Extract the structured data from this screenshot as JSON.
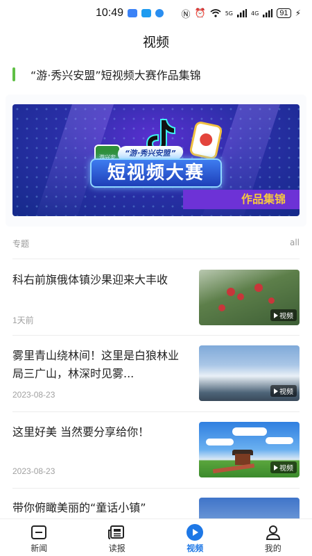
{
  "status_bar": {
    "time": "10:49",
    "battery": "91",
    "network_labels": [
      "5G",
      "4G"
    ]
  },
  "header": {
    "title": "视频"
  },
  "collection": {
    "title": "“游·秀兴安盟”短视频大赛作品集锦"
  },
  "banner": {
    "logo_text": "游兴安",
    "subtitle": "“游·秀兴安盟”",
    "main_text": "短视频大赛",
    "tag_text": "作品集锦"
  },
  "section": {
    "label": "专题",
    "more": "all"
  },
  "video_badge_label": "视频",
  "news_items": [
    {
      "title": "科右前旗俄体镇沙果迎来大丰收",
      "date": "1天前"
    },
    {
      "title": "雾里青山绕林间！这里是白狼林业局三广山，林深时见雾...",
      "date": "2023-08-23"
    },
    {
      "title": "这里好美 当然要分享给你！",
      "date": "2023-08-23"
    },
    {
      "title": "带你俯瞰美丽的“童话小镇”",
      "date": ""
    }
  ],
  "tabbar": {
    "items": [
      {
        "label": "新闻",
        "icon": "news-icon"
      },
      {
        "label": "读报",
        "icon": "newspaper-icon"
      },
      {
        "label": "视频",
        "icon": "play-icon"
      },
      {
        "label": "我的",
        "icon": "user-icon"
      }
    ],
    "active_index": 2
  },
  "colors": {
    "accent": "#1e78e6",
    "green_marker": "#5fbf45",
    "banner_purple": "#6d32d6"
  }
}
